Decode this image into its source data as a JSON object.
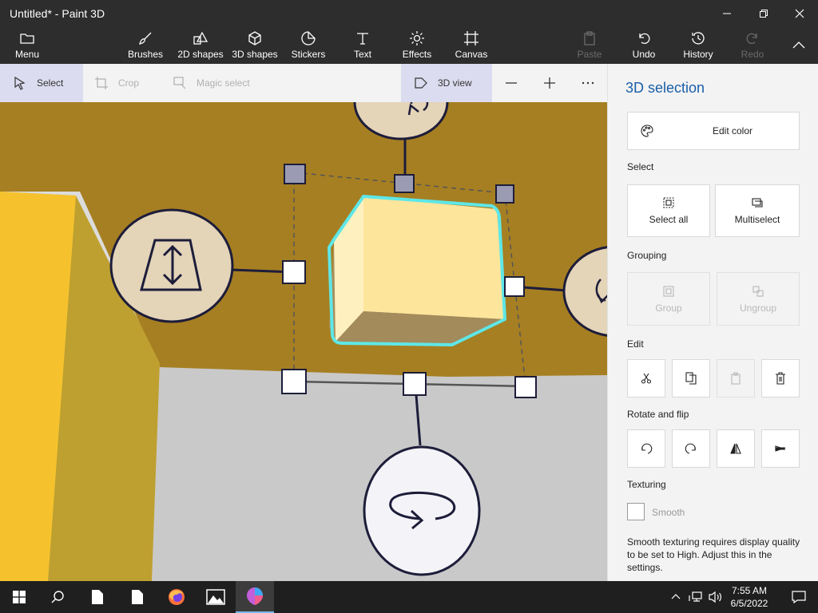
{
  "window": {
    "title": "Untitled* - Paint 3D"
  },
  "ribbon": {
    "menu": "Menu",
    "brushes": "Brushes",
    "shapes2d": "2D shapes",
    "shapes3d": "3D shapes",
    "stickers": "Stickers",
    "text": "Text",
    "effects": "Effects",
    "canvas": "Canvas",
    "paste": "Paste",
    "undo": "Undo",
    "history": "History",
    "redo": "Redo"
  },
  "toolbar": {
    "select": "Select",
    "crop": "Crop",
    "magic_select": "Magic select",
    "view3d": "3D view"
  },
  "panel": {
    "title": "3D selection",
    "edit_color": "Edit color",
    "select_header": "Select",
    "select_all": "Select all",
    "multiselect": "Multiselect",
    "grouping_header": "Grouping",
    "group": "Group",
    "ungroup": "Ungroup",
    "edit_header": "Edit",
    "rotate_header": "Rotate and flip",
    "texturing_header": "Texturing",
    "smooth": "Smooth",
    "smooth_note": "Smooth texturing requires display quality to be set to High. Adjust this in the settings."
  },
  "taskbar": {
    "time": "7:55 AM",
    "date": "6/5/2022"
  },
  "colors": {
    "accent": "#1a5ea8",
    "selection_outline": "#5ee7e7",
    "ribbon_bg": "#2d2d2d"
  }
}
